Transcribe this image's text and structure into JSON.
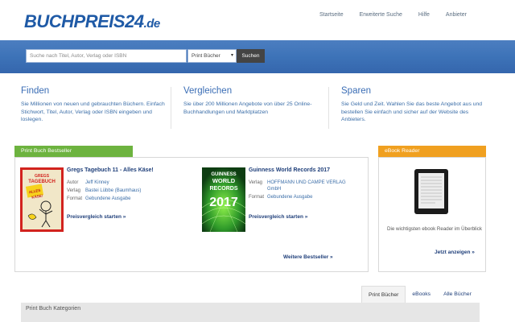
{
  "logo": {
    "part1": "BUCHPREIS",
    "part2": "24",
    "part3": ".de"
  },
  "nav": [
    {
      "label": "Startseite"
    },
    {
      "label": "Erweiterte Suche"
    },
    {
      "label": "Hilfe"
    },
    {
      "label": "Anbieter"
    }
  ],
  "search": {
    "placeholder": "Suche nach Titel, Autor, Verlag oder ISBN",
    "category_selected": "Print Bücher",
    "button_label": "Suchen"
  },
  "features": [
    {
      "title": "Finden",
      "text": "Sie Millionen von neuen und gebrauchten Büchern. Einfach Stichwort, Titel, Autor, Verlag oder ISBN eingeben und loslegen."
    },
    {
      "title": "Vergleichen",
      "text": "Sie über 200 Millionen Angebote von über 25 Online-Buchhandlungen und Marktplatzen"
    },
    {
      "title": "Sparen",
      "text": "Sie Geld und Zeit. Wahlen Sie das beste Angebot aus und bestellen Sie einfach und sicher auf der Website des Anbieters."
    }
  ],
  "bestseller": {
    "header": "Print Buch Bestseller",
    "books": [
      {
        "cover_title": "GREGS TAGEBUCH",
        "cover_sub": "ALLES KÄSE!",
        "title": "Gregs Tagebuch 11 - Alles Käse!",
        "rows": [
          {
            "k": "Autor",
            "v": "Jeff Kinney"
          },
          {
            "k": "Verlag",
            "v": "Bastei Lübbe (Baumhaus)"
          },
          {
            "k": "Format",
            "v": "Gebundene Ausgabe"
          }
        ],
        "link": "Preisvergleich starten »"
      },
      {
        "cover_title": "GUINNESS WORLD RECORDS",
        "cover_sub": "2017",
        "title": "Guinness World Records 2017",
        "rows": [
          {
            "k": "Verlag",
            "v": "HOFFMANN UND CAMPE VERLAG GmbH"
          },
          {
            "k": "Format",
            "v": "Gebundene Ausgabe"
          }
        ],
        "link": "Preisvergleich starten »"
      }
    ],
    "more_link": "Weitere Bestseller »"
  },
  "ebook": {
    "header": "eBook Reader",
    "text": "Die wichtigsten ebook Reader im Überblick",
    "link": "Jetzt anzeigen »"
  },
  "tabs": [
    {
      "label": "Print Bücher",
      "active": true
    },
    {
      "label": "eBooks",
      "active": false
    },
    {
      "label": "Alle Bücher",
      "active": false
    }
  ],
  "categories": {
    "header": "Print Buch Kategorien"
  },
  "colors": {
    "brand_blue": "#1f5aa6",
    "band_blue": "#3d73b8",
    "bestseller_green": "#6db33f",
    "ebook_orange": "#f0a020"
  }
}
